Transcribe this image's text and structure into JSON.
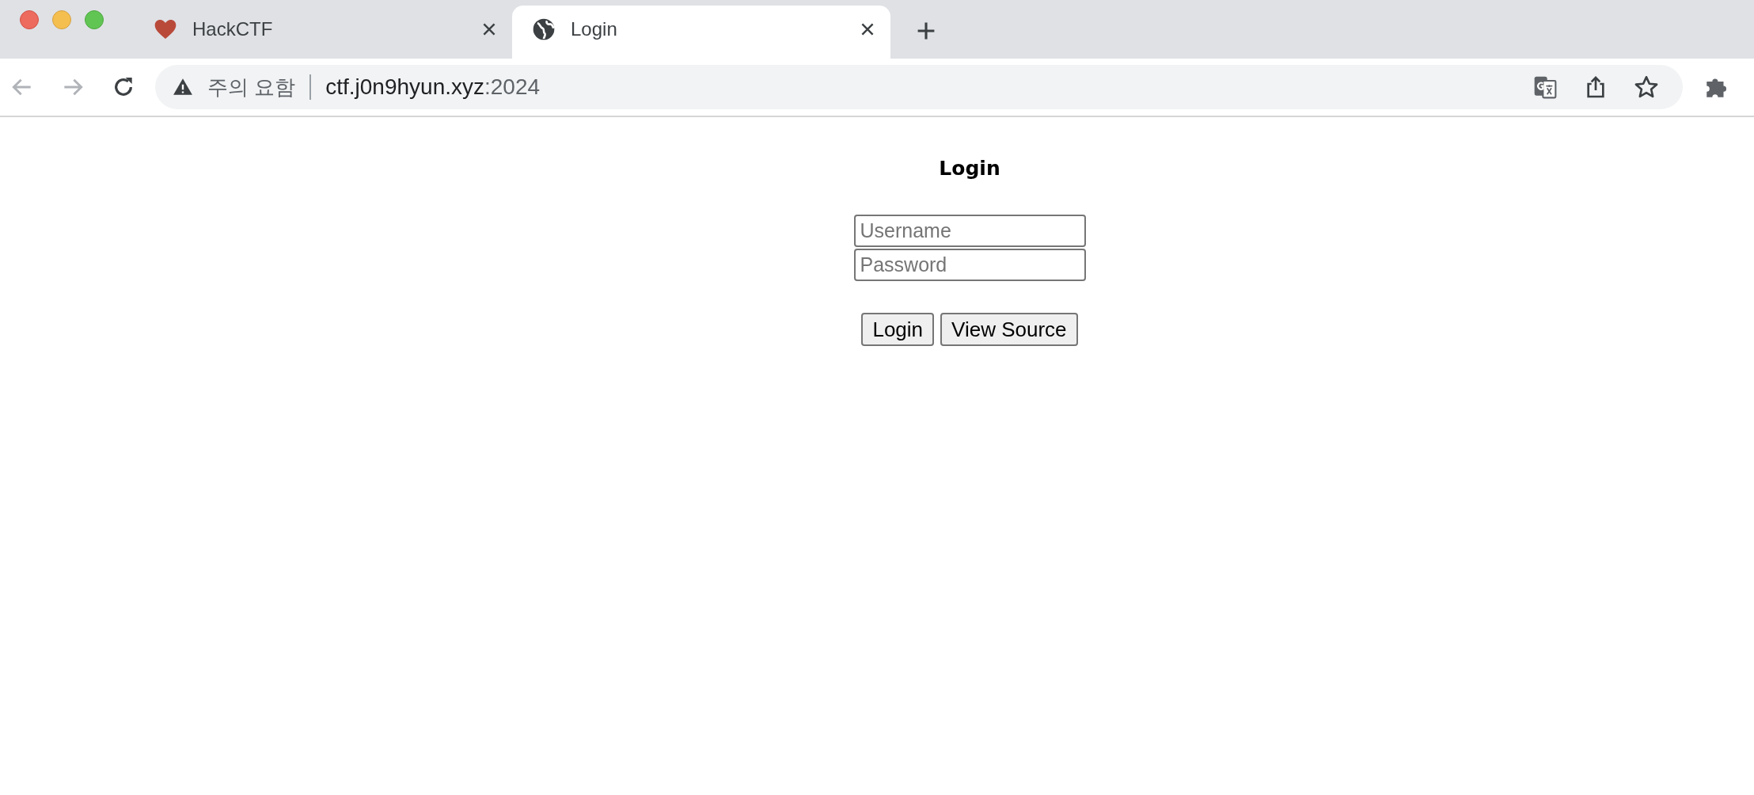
{
  "tabs": [
    {
      "title": "HackCTF",
      "selected": false
    },
    {
      "title": "Login",
      "selected": true
    }
  ],
  "address_bar": {
    "security_label": "주의 요함",
    "host": "ctf.j0n9hyun.xyz",
    "port": ":2024"
  },
  "page": {
    "heading": "Login",
    "fields": [
      {
        "placeholder": "Username"
      },
      {
        "placeholder": "Password"
      }
    ],
    "buttons": [
      "Login",
      "View Source"
    ]
  }
}
